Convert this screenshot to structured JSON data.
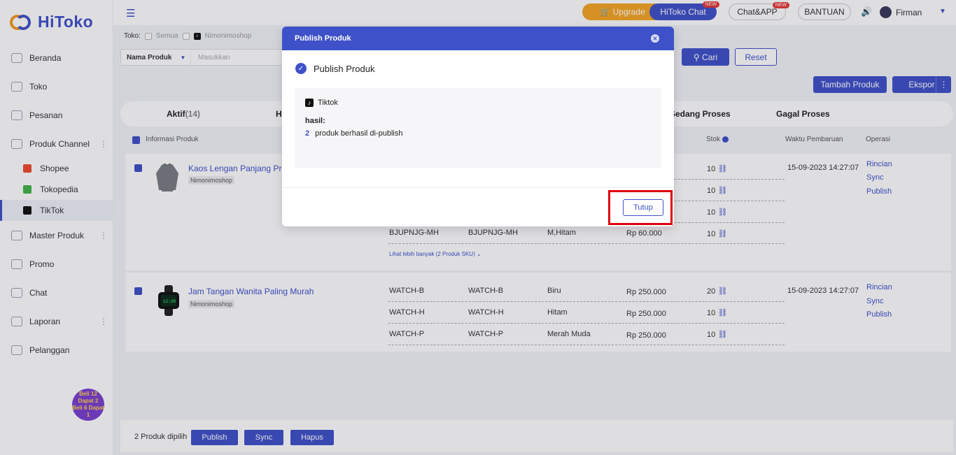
{
  "brand": {
    "name": "HiToko"
  },
  "sidebar": {
    "items": [
      {
        "label": "Beranda",
        "icon": "home-icon"
      },
      {
        "label": "Toko",
        "icon": "store-icon"
      },
      {
        "label": "Pesanan",
        "icon": "orders-icon"
      },
      {
        "label": "Produk Channel",
        "icon": "grid-icon"
      },
      {
        "label": "Master Produk",
        "icon": "box-icon"
      },
      {
        "label": "Promo",
        "icon": "promo-icon"
      },
      {
        "label": "Chat",
        "icon": "chat-icon"
      },
      {
        "label": "Laporan",
        "icon": "report-icon"
      },
      {
        "label": "Pelanggan",
        "icon": "customers-icon"
      }
    ],
    "channels": [
      {
        "label": "Shopee",
        "color": "#ee4d2d"
      },
      {
        "label": "Tokopedia",
        "color": "#42b549"
      },
      {
        "label": "TikTok",
        "color": "#111111"
      }
    ],
    "promo_badge": {
      "line1": "Beli 12 Dapat 2",
      "line2": "Beli 6 Dapat 1"
    }
  },
  "topbar": {
    "upgrade": "Upgrade",
    "hitoko_chat": "HiToko Chat",
    "chat_app": "Chat&APP",
    "bantuan": "BANTUAN",
    "new_badge": "NEW",
    "user": "Firman"
  },
  "filters": {
    "store_label": "Toko:",
    "all_label": "Semua",
    "store_name": "Nimonimoshop",
    "field_select": "Nama Produk",
    "field_placeholder": "Masukkan",
    "search_button": "Cari",
    "reset_button": "Reset"
  },
  "actions": {
    "add_product": "Tambah Produk",
    "export": "Ekspor"
  },
  "tabs": [
    {
      "label": "Aktif",
      "count": "(14)"
    },
    {
      "label": "H",
      "count": ""
    },
    {
      "label": "Sedang Proses",
      "count": ""
    },
    {
      "label": "Gagal Proses",
      "count": ""
    }
  ],
  "table": {
    "headers": {
      "info": "Informasi Produk",
      "stock": "Stok",
      "updated": "Waktu Pembaruan",
      "ops": "Operasi"
    },
    "products": [
      {
        "name": "Kaos Lengan Panjang Pria Te",
        "store": "Nimonimoshop",
        "updated": "15-09-2023 14:27:07",
        "ops": [
          "Rincian",
          "Sync",
          "Publish"
        ],
        "stocks_top": [
          "10",
          "10",
          "10"
        ],
        "visible_sku": {
          "sku": "BJUPNJG-MH",
          "seller_sku": "BJUPNJG-MH",
          "variant": "M,Hitam",
          "price": "Rp 60.000",
          "stock": "10"
        },
        "more": "Lihat lebih banyak (2 Produk SKU)"
      },
      {
        "name": "Jam Tangan Wanita Paling Murah",
        "store": "Nimonimoshop",
        "updated": "15-09-2023 14:27:07",
        "ops": [
          "Rincian",
          "Sync",
          "Publish"
        ],
        "skus": [
          {
            "sku": "WATCH-B",
            "seller_sku": "WATCH-B",
            "variant": "Biru",
            "price": "Rp 250.000",
            "stock": "20"
          },
          {
            "sku": "WATCH-H",
            "seller_sku": "WATCH-H",
            "variant": "Hitam",
            "price": "Rp 250.000",
            "stock": "10"
          },
          {
            "sku": "WATCH-P",
            "seller_sku": "WATCH-P",
            "variant": "Merah Muda",
            "price": "Rp 250.000",
            "stock": "10"
          }
        ]
      }
    ]
  },
  "bottom": {
    "selected_text": "2 Produk dipilih",
    "publish": "Publish",
    "sync": "Sync",
    "delete": "Hapus"
  },
  "modal": {
    "title": "Publish Produk",
    "status": "Publish Produk",
    "platform": "Tiktok",
    "result_label": "hasil:",
    "result_count": "2",
    "result_text": "produk berhasil di-publish",
    "close_button": "Tutup"
  },
  "colors": {
    "primary": "#3f51c8",
    "accent": "#f5a623",
    "highlight": "#e0000f"
  }
}
